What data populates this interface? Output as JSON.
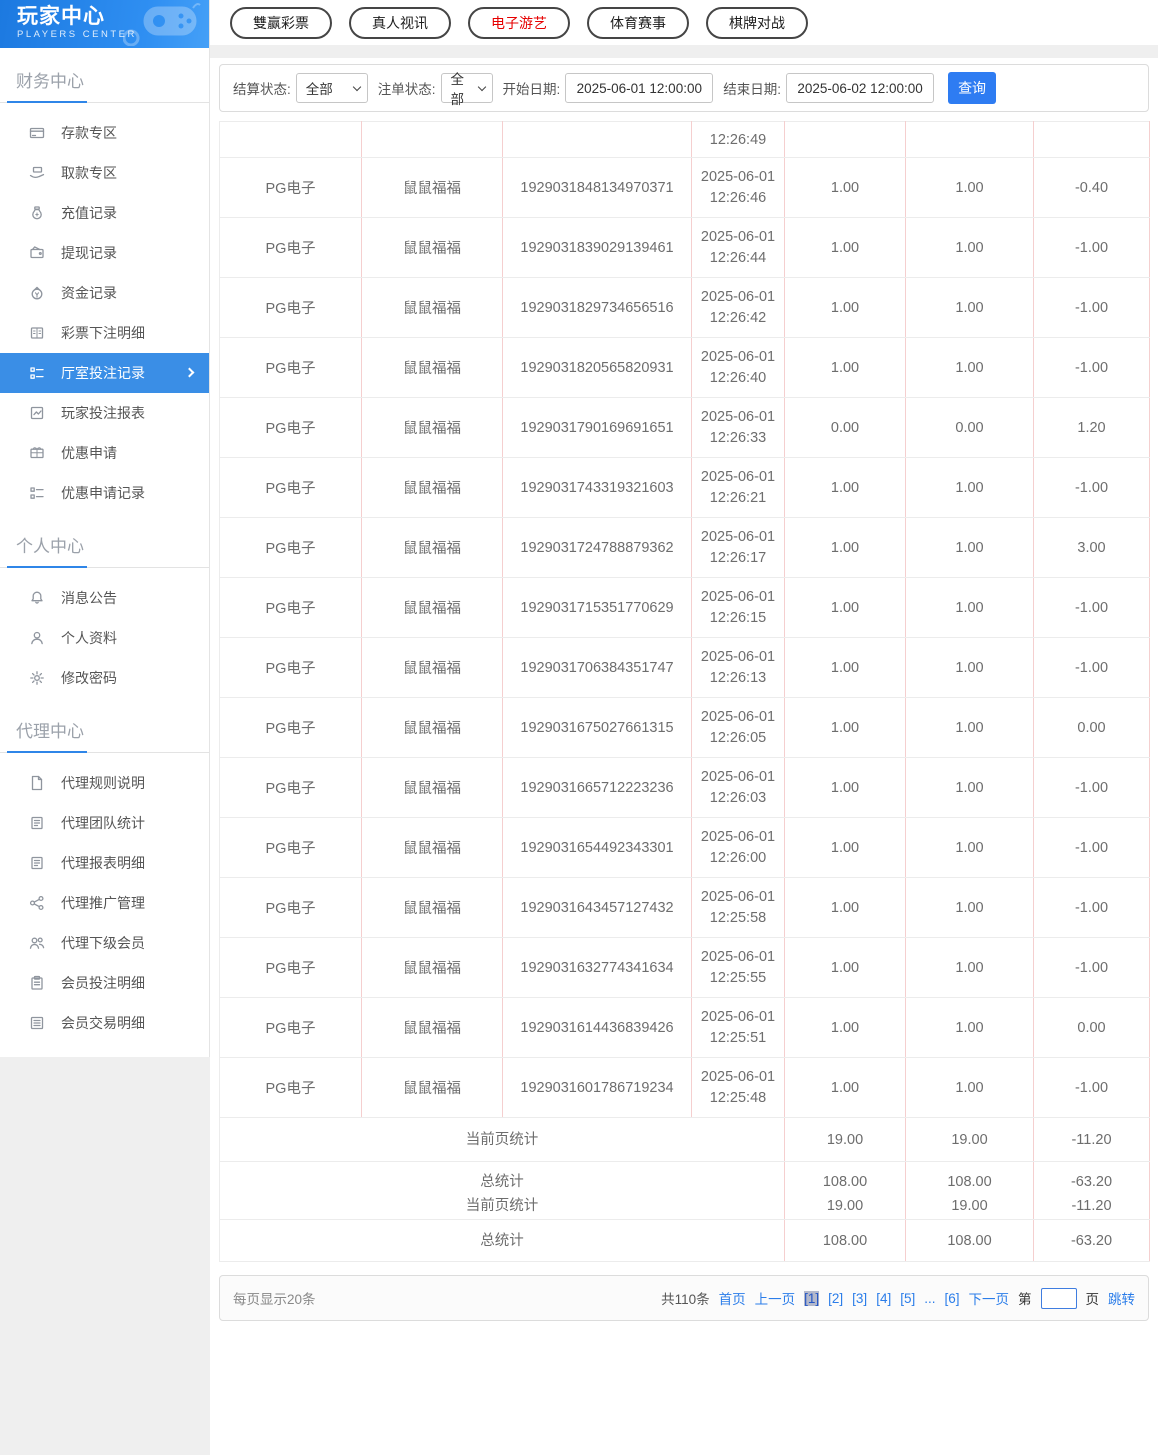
{
  "colors": {
    "accent_blue": "#3a8ee6",
    "button_blue": "#2e7cf2",
    "active_tab_red": "#e60000",
    "table_divider_pink": "#f5cfcf",
    "page_highlight": "#b3b8cb"
  },
  "sidebar": {
    "title": "玩家中心",
    "subtitle": "PLAYERS CENTER",
    "sections": [
      {
        "heading": "财务中心",
        "items": [
          {
            "label": "存款专区",
            "icon": "deposit-card-icon"
          },
          {
            "label": "取款专区",
            "icon": "withdraw-hand-icon"
          },
          {
            "label": "充值记录",
            "icon": "recharge-record-icon"
          },
          {
            "label": "提现记录",
            "icon": "withdrawal-record-icon"
          },
          {
            "label": "资金记录",
            "icon": "funds-record-icon"
          },
          {
            "label": "彩票下注明细",
            "icon": "lottery-bet-detail-icon"
          },
          {
            "label": "厅室投注记录",
            "icon": "hall-bet-record-icon",
            "active": true
          },
          {
            "label": "玩家投注报表",
            "icon": "player-bet-report-icon"
          },
          {
            "label": "优惠申请",
            "icon": "promo-apply-icon"
          },
          {
            "label": "优惠申请记录",
            "icon": "promo-record-icon"
          }
        ]
      },
      {
        "heading": "个人中心",
        "items": [
          {
            "label": "消息公告",
            "icon": "bell-icon"
          },
          {
            "label": "个人资料",
            "icon": "person-icon"
          },
          {
            "label": "修改密码",
            "icon": "gear-icon"
          }
        ]
      },
      {
        "heading": "代理中心",
        "items": [
          {
            "label": "代理规则说明",
            "icon": "document-icon"
          },
          {
            "label": "代理团队统计",
            "icon": "report-icon"
          },
          {
            "label": "代理报表明细",
            "icon": "report-icon"
          },
          {
            "label": "代理推广管理",
            "icon": "share-icon"
          },
          {
            "label": "代理下级会员",
            "icon": "people-icon"
          },
          {
            "label": "会员投注明细",
            "icon": "clipboard-icon"
          },
          {
            "label": "会员交易明细",
            "icon": "list-icon"
          }
        ]
      }
    ]
  },
  "topbar": {
    "tabs": [
      {
        "label": "雙赢彩票",
        "active": false
      },
      {
        "label": "真人视讯",
        "active": false
      },
      {
        "label": "电子游艺",
        "active": true
      },
      {
        "label": "体育赛事",
        "active": false
      },
      {
        "label": "棋牌对战",
        "active": false
      }
    ]
  },
  "filters": {
    "settle_status_label": "结算状态:",
    "settle_status_value": "全部",
    "order_status_label": "注单状态:",
    "order_status_value": "全部",
    "start_date_label": "开始日期:",
    "start_date_value": "2025-06-01 12:00:00",
    "end_date_label": "结束日期:",
    "end_date_value": "2025-06-02 12:00:00",
    "search_button": "查询"
  },
  "table": {
    "partial_row_time": "12:26:49",
    "rows": [
      {
        "provider": "PG电子",
        "game": "鼠鼠福福",
        "order": "1929031848134970371",
        "date": "2025-06-01",
        "time": "12:26:46",
        "bet": "1.00",
        "valid": "1.00",
        "win": "-0.40"
      },
      {
        "provider": "PG电子",
        "game": "鼠鼠福福",
        "order": "1929031839029139461",
        "date": "2025-06-01",
        "time": "12:26:44",
        "bet": "1.00",
        "valid": "1.00",
        "win": "-1.00"
      },
      {
        "provider": "PG电子",
        "game": "鼠鼠福福",
        "order": "1929031829734656516",
        "date": "2025-06-01",
        "time": "12:26:42",
        "bet": "1.00",
        "valid": "1.00",
        "win": "-1.00"
      },
      {
        "provider": "PG电子",
        "game": "鼠鼠福福",
        "order": "1929031820565820931",
        "date": "2025-06-01",
        "time": "12:26:40",
        "bet": "1.00",
        "valid": "1.00",
        "win": "-1.00"
      },
      {
        "provider": "PG电子",
        "game": "鼠鼠福福",
        "order": "1929031790169691651",
        "date": "2025-06-01",
        "time": "12:26:33",
        "bet": "0.00",
        "valid": "0.00",
        "win": "1.20"
      },
      {
        "provider": "PG电子",
        "game": "鼠鼠福福",
        "order": "1929031743319321603",
        "date": "2025-06-01",
        "time": "12:26:21",
        "bet": "1.00",
        "valid": "1.00",
        "win": "-1.00"
      },
      {
        "provider": "PG电子",
        "game": "鼠鼠福福",
        "order": "1929031724788879362",
        "date": "2025-06-01",
        "time": "12:26:17",
        "bet": "1.00",
        "valid": "1.00",
        "win": "3.00"
      },
      {
        "provider": "PG电子",
        "game": "鼠鼠福福",
        "order": "1929031715351770629",
        "date": "2025-06-01",
        "time": "12:26:15",
        "bet": "1.00",
        "valid": "1.00",
        "win": "-1.00"
      },
      {
        "provider": "PG电子",
        "game": "鼠鼠福福",
        "order": "1929031706384351747",
        "date": "2025-06-01",
        "time": "12:26:13",
        "bet": "1.00",
        "valid": "1.00",
        "win": "-1.00"
      },
      {
        "provider": "PG电子",
        "game": "鼠鼠福福",
        "order": "1929031675027661315",
        "date": "2025-06-01",
        "time": "12:26:05",
        "bet": "1.00",
        "valid": "1.00",
        "win": "0.00"
      },
      {
        "provider": "PG电子",
        "game": "鼠鼠福福",
        "order": "1929031665712223236",
        "date": "2025-06-01",
        "time": "12:26:03",
        "bet": "1.00",
        "valid": "1.00",
        "win": "-1.00"
      },
      {
        "provider": "PG电子",
        "game": "鼠鼠福福",
        "order": "1929031654492343301",
        "date": "2025-06-01",
        "time": "12:26:00",
        "bet": "1.00",
        "valid": "1.00",
        "win": "-1.00"
      },
      {
        "provider": "PG电子",
        "game": "鼠鼠福福",
        "order": "1929031643457127432",
        "date": "2025-06-01",
        "time": "12:25:58",
        "bet": "1.00",
        "valid": "1.00",
        "win": "-1.00"
      },
      {
        "provider": "PG电子",
        "game": "鼠鼠福福",
        "order": "1929031632774341634",
        "date": "2025-06-01",
        "time": "12:25:55",
        "bet": "1.00",
        "valid": "1.00",
        "win": "-1.00"
      },
      {
        "provider": "PG电子",
        "game": "鼠鼠福福",
        "order": "1929031614436839426",
        "date": "2025-06-01",
        "time": "12:25:51",
        "bet": "1.00",
        "valid": "1.00",
        "win": "0.00"
      },
      {
        "provider": "PG电子",
        "game": "鼠鼠福福",
        "order": "1929031601786719234",
        "date": "2025-06-01",
        "time": "12:25:48",
        "bet": "1.00",
        "valid": "1.00",
        "win": "-1.00"
      }
    ],
    "summary_rows": [
      {
        "cells": [
          "当前页统计",
          "19.00",
          "19.00",
          "-11.20"
        ]
      },
      {
        "cells": [
          "总统计",
          "108.00",
          "108.00",
          "-63.20"
        ],
        "overlap_cells": [
          "当前页统计",
          "19.00",
          "19.00",
          "-11.20"
        ]
      },
      {
        "cells": [
          "总统计",
          "108.00",
          "108.00",
          "-63.20"
        ]
      }
    ]
  },
  "pagination": {
    "page_size_text": "每页显示20条",
    "total_text": "共110条",
    "first_label": "首页",
    "prev_label": "上一页",
    "pages": [
      {
        "label": "[1]",
        "active": true
      },
      {
        "label": "[2]"
      },
      {
        "label": "[3]"
      },
      {
        "label": "[4]"
      },
      {
        "label": "[5]"
      },
      {
        "label": "..."
      },
      {
        "label": "[6]"
      }
    ],
    "next_label": "下一页",
    "goto_prefix": "第",
    "goto_suffix": "页",
    "goto_button": "跳转"
  }
}
